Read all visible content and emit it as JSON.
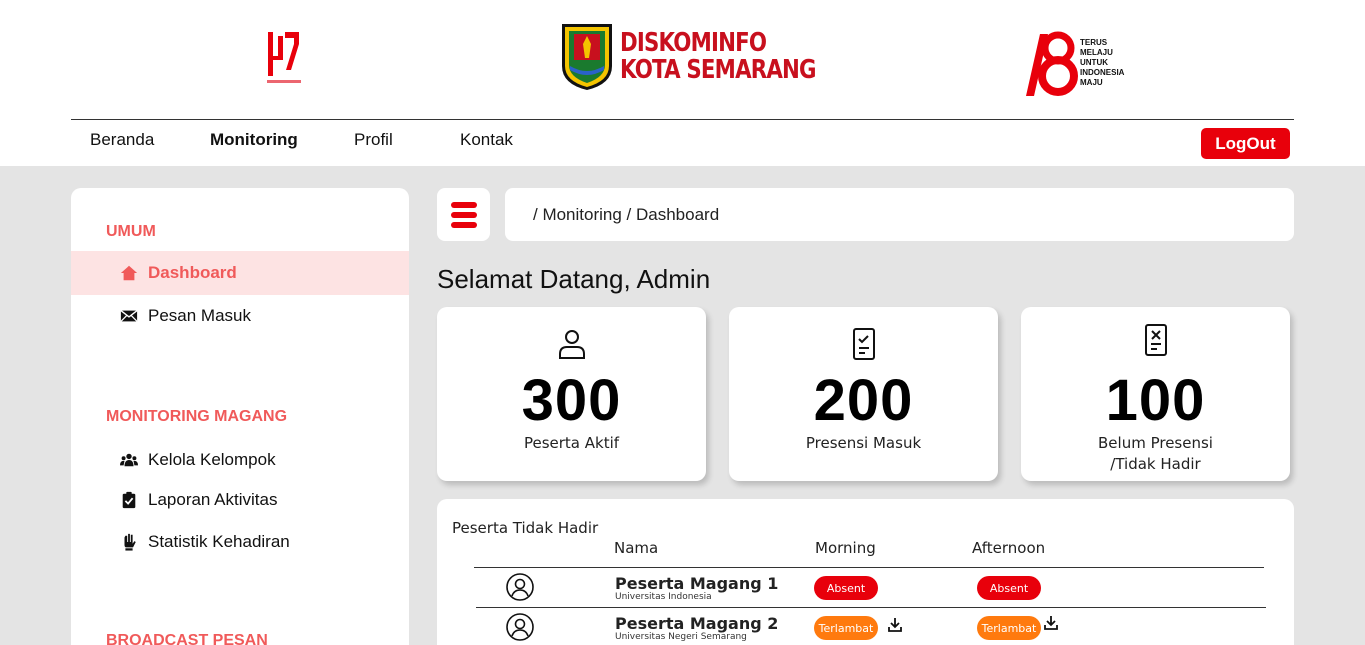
{
  "header": {
    "brand_line1": "DISKOMINFO",
    "brand_line2": "KOTA SEMARANG",
    "slogan": [
      "TERUS",
      "MELAJU",
      "UNTUK",
      "INDONESIA",
      "MAJU"
    ],
    "nav": [
      {
        "label": "Beranda"
      },
      {
        "label": "Monitoring"
      },
      {
        "label": "Profil"
      },
      {
        "label": "Kontak"
      }
    ],
    "logout_label": "LogOut"
  },
  "sidebar": {
    "sections": [
      {
        "title": "UMUM"
      },
      {
        "title": "MONITORING MAGANG"
      },
      {
        "title": "BROADCAST PESAN"
      }
    ],
    "items": [
      {
        "label": "Dashboard",
        "icon": "home-icon"
      },
      {
        "label": "Pesan Masuk",
        "icon": "envelope-icon"
      },
      {
        "label": "Kelola Kelompok",
        "icon": "users-icon"
      },
      {
        "label": "Laporan Aktivitas",
        "icon": "clipboard-check-icon"
      },
      {
        "label": "Statistik Kehadiran",
        "icon": "hand-icon"
      }
    ]
  },
  "main": {
    "breadcrumb": "/ Monitoring / Dashboard",
    "welcome": "Selamat Datang, Admin",
    "cards": [
      {
        "value": "300",
        "label": "Peserta Aktif",
        "icon": "user-icon"
      },
      {
        "value": "200",
        "label": "Presensi Masuk",
        "icon": "document-check-icon"
      },
      {
        "value": "100",
        "label_line1": "Belum Presensi",
        "label_line2": "/Tidak Hadir",
        "icon": "document-x-icon"
      }
    ],
    "table": {
      "title": "Peserta Tidak Hadir",
      "columns": [
        "Nama",
        "Morning",
        "Afternoon"
      ],
      "rows": [
        {
          "name": "Peserta Magang 1",
          "university": "Universitas Indonesia",
          "morning": "Absent",
          "afternoon": "Absent"
        },
        {
          "name": "Peserta Magang 2",
          "university": "Universitas Negeri Semarang",
          "morning": "Terlambat",
          "afternoon": "Terlambat"
        }
      ]
    }
  },
  "colors": {
    "accent_red": "#e8000b",
    "section_red": "#f05a5a",
    "active_bg": "#fde3e3",
    "late_orange": "#ff7a0e",
    "page_bg": "#e4e4e4"
  }
}
